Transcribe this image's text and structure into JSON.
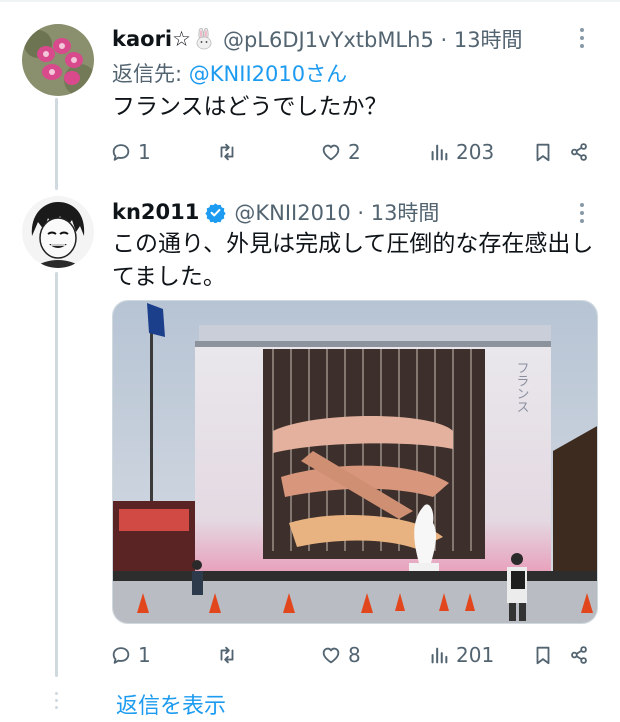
{
  "tweets": [
    {
      "display_name": "kaori☆",
      "handle_time": "@pL6DJ1vYxtbMLh5 · 13時間",
      "reply_prefix": "返信先: ",
      "reply_mention": "@KNII2010さん",
      "text": "フランスはどうでしたか？",
      "stats": {
        "replies": "1",
        "retweets": "",
        "likes": "2",
        "views": "203"
      }
    },
    {
      "display_name": "kn2011",
      "handle_time": "@KNII2010 · 13時間",
      "text_line1": "この通り、外見は完成して圧倒的な存在感出し",
      "text_line2": "てました。",
      "image_sign": "フランス",
      "stats": {
        "replies": "1",
        "retweets": "",
        "likes": "8",
        "views": "201"
      }
    }
  ],
  "show_replies_label": "返信を表示",
  "icons": [
    "reply-icon",
    "retweet-icon",
    "like-icon",
    "views-icon",
    "bookmark-icon",
    "share-icon",
    "more-icon",
    "verified-badge-icon",
    "rabbit-emoji-icon"
  ],
  "colors": {
    "accent": "#1d9bf0",
    "secondary_text": "#536471",
    "thread_line": "#cfd9de"
  }
}
